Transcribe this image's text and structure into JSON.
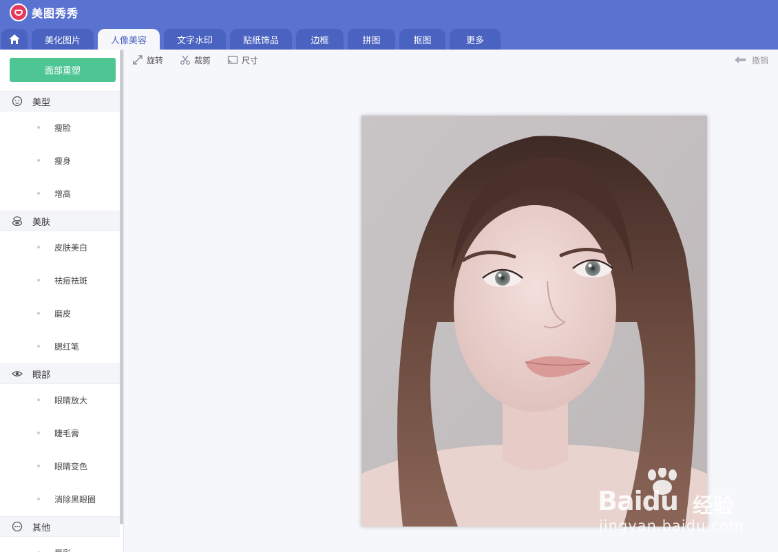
{
  "app": {
    "title": "美图秀秀"
  },
  "tabs": [
    {
      "label": "美化图片"
    },
    {
      "label": "人像美容"
    },
    {
      "label": "文字水印"
    },
    {
      "label": "贴纸饰品"
    },
    {
      "label": "边框"
    },
    {
      "label": "拼图"
    },
    {
      "label": "抠图"
    },
    {
      "label": "更多"
    }
  ],
  "active_tab": "人像美容",
  "sidebar": {
    "reset_button": "面部重塑",
    "sections": [
      {
        "label": "美型",
        "icon": "face-icon",
        "items": [
          "瘦脸",
          "瘦身",
          "增高"
        ]
      },
      {
        "label": "美肤",
        "icon": "skin-icon",
        "items": [
          "皮肤美白",
          "祛痘祛斑",
          "磨皮",
          "腮红笔"
        ]
      },
      {
        "label": "眼部",
        "icon": "eye-icon",
        "items": [
          "眼睛放大",
          "睫毛膏",
          "眼睛变色",
          "消除黑眼圈"
        ]
      },
      {
        "label": "其他",
        "icon": "more-icon",
        "items": [
          "唇彩"
        ]
      }
    ]
  },
  "toolbar": {
    "rotate": "旋转",
    "crop": "裁剪",
    "size": "尺寸",
    "undo": "撤销"
  },
  "watermark": {
    "brand": "Bai",
    "brand_suffix": "du",
    "brand_cn": "经验",
    "url": "jingyan.baidu.com"
  },
  "colors": {
    "header": "#5b73d0",
    "tab": "#4b63c0",
    "accent_green": "#4ec694",
    "canvas": "#f6f7fb"
  }
}
